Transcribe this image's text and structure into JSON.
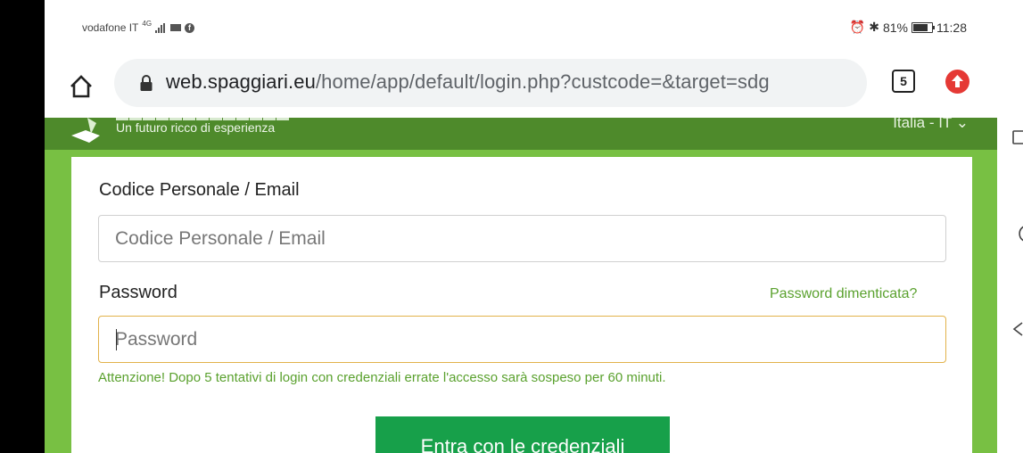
{
  "status_bar": {
    "carrier": "vodafone IT",
    "network": "4G",
    "battery": "81%",
    "battery_level": 0.81,
    "time": "11:28"
  },
  "browser": {
    "url_host": "web.spaggiari.eu",
    "url_path": "/home/app/default/login.php?custcode=&target=sdg",
    "tab_count": "5"
  },
  "header": {
    "tagline": "Un futuro ricco di esperienza",
    "language": "Italia - IT"
  },
  "form": {
    "email_label": "Codice Personale / Email",
    "email_placeholder": "Codice Personale / Email",
    "password_label": "Password",
    "forgot_link": "Password dimenticata?",
    "password_placeholder": "Password",
    "warning": "Attenzione! Dopo 5 tentativi di login con credenziali errate l'accesso sarà sospeso per 60 minuti.",
    "submit_label": "Entra con le credenziali"
  },
  "colors": {
    "header_green": "#4e8a2b",
    "page_green": "#78c043",
    "link_green": "#5aa12e",
    "button_green": "#17a04a",
    "focus_border": "#e2b24a"
  }
}
